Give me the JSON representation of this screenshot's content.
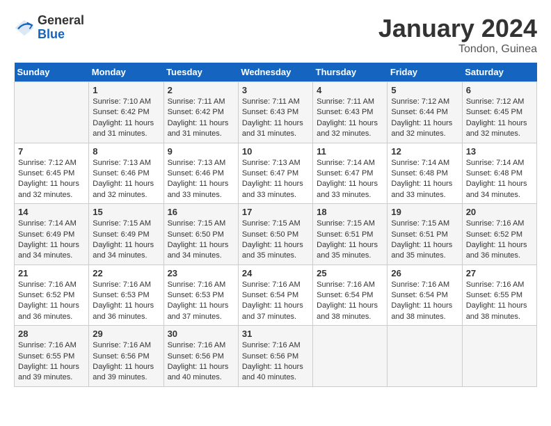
{
  "header": {
    "logo_line1": "General",
    "logo_line2": "Blue",
    "month": "January 2024",
    "location": "Tondon, Guinea"
  },
  "weekdays": [
    "Sunday",
    "Monday",
    "Tuesday",
    "Wednesday",
    "Thursday",
    "Friday",
    "Saturday"
  ],
  "weeks": [
    [
      {
        "day": "",
        "info": ""
      },
      {
        "day": "1",
        "info": "Sunrise: 7:10 AM\nSunset: 6:42 PM\nDaylight: 11 hours and 31 minutes."
      },
      {
        "day": "2",
        "info": "Sunrise: 7:11 AM\nSunset: 6:42 PM\nDaylight: 11 hours and 31 minutes."
      },
      {
        "day": "3",
        "info": "Sunrise: 7:11 AM\nSunset: 6:43 PM\nDaylight: 11 hours and 31 minutes."
      },
      {
        "day": "4",
        "info": "Sunrise: 7:11 AM\nSunset: 6:43 PM\nDaylight: 11 hours and 32 minutes."
      },
      {
        "day": "5",
        "info": "Sunrise: 7:12 AM\nSunset: 6:44 PM\nDaylight: 11 hours and 32 minutes."
      },
      {
        "day": "6",
        "info": "Sunrise: 7:12 AM\nSunset: 6:45 PM\nDaylight: 11 hours and 32 minutes."
      }
    ],
    [
      {
        "day": "7",
        "info": "Sunrise: 7:12 AM\nSunset: 6:45 PM\nDaylight: 11 hours and 32 minutes."
      },
      {
        "day": "8",
        "info": "Sunrise: 7:13 AM\nSunset: 6:46 PM\nDaylight: 11 hours and 32 minutes."
      },
      {
        "day": "9",
        "info": "Sunrise: 7:13 AM\nSunset: 6:46 PM\nDaylight: 11 hours and 33 minutes."
      },
      {
        "day": "10",
        "info": "Sunrise: 7:13 AM\nSunset: 6:47 PM\nDaylight: 11 hours and 33 minutes."
      },
      {
        "day": "11",
        "info": "Sunrise: 7:14 AM\nSunset: 6:47 PM\nDaylight: 11 hours and 33 minutes."
      },
      {
        "day": "12",
        "info": "Sunrise: 7:14 AM\nSunset: 6:48 PM\nDaylight: 11 hours and 33 minutes."
      },
      {
        "day": "13",
        "info": "Sunrise: 7:14 AM\nSunset: 6:48 PM\nDaylight: 11 hours and 34 minutes."
      }
    ],
    [
      {
        "day": "14",
        "info": "Sunrise: 7:14 AM\nSunset: 6:49 PM\nDaylight: 11 hours and 34 minutes."
      },
      {
        "day": "15",
        "info": "Sunrise: 7:15 AM\nSunset: 6:49 PM\nDaylight: 11 hours and 34 minutes."
      },
      {
        "day": "16",
        "info": "Sunrise: 7:15 AM\nSunset: 6:50 PM\nDaylight: 11 hours and 34 minutes."
      },
      {
        "day": "17",
        "info": "Sunrise: 7:15 AM\nSunset: 6:50 PM\nDaylight: 11 hours and 35 minutes."
      },
      {
        "day": "18",
        "info": "Sunrise: 7:15 AM\nSunset: 6:51 PM\nDaylight: 11 hours and 35 minutes."
      },
      {
        "day": "19",
        "info": "Sunrise: 7:15 AM\nSunset: 6:51 PM\nDaylight: 11 hours and 35 minutes."
      },
      {
        "day": "20",
        "info": "Sunrise: 7:16 AM\nSunset: 6:52 PM\nDaylight: 11 hours and 36 minutes."
      }
    ],
    [
      {
        "day": "21",
        "info": "Sunrise: 7:16 AM\nSunset: 6:52 PM\nDaylight: 11 hours and 36 minutes."
      },
      {
        "day": "22",
        "info": "Sunrise: 7:16 AM\nSunset: 6:53 PM\nDaylight: 11 hours and 36 minutes."
      },
      {
        "day": "23",
        "info": "Sunrise: 7:16 AM\nSunset: 6:53 PM\nDaylight: 11 hours and 37 minutes."
      },
      {
        "day": "24",
        "info": "Sunrise: 7:16 AM\nSunset: 6:54 PM\nDaylight: 11 hours and 37 minutes."
      },
      {
        "day": "25",
        "info": "Sunrise: 7:16 AM\nSunset: 6:54 PM\nDaylight: 11 hours and 38 minutes."
      },
      {
        "day": "26",
        "info": "Sunrise: 7:16 AM\nSunset: 6:54 PM\nDaylight: 11 hours and 38 minutes."
      },
      {
        "day": "27",
        "info": "Sunrise: 7:16 AM\nSunset: 6:55 PM\nDaylight: 11 hours and 38 minutes."
      }
    ],
    [
      {
        "day": "28",
        "info": "Sunrise: 7:16 AM\nSunset: 6:55 PM\nDaylight: 11 hours and 39 minutes."
      },
      {
        "day": "29",
        "info": "Sunrise: 7:16 AM\nSunset: 6:56 PM\nDaylight: 11 hours and 39 minutes."
      },
      {
        "day": "30",
        "info": "Sunrise: 7:16 AM\nSunset: 6:56 PM\nDaylight: 11 hours and 40 minutes."
      },
      {
        "day": "31",
        "info": "Sunrise: 7:16 AM\nSunset: 6:56 PM\nDaylight: 11 hours and 40 minutes."
      },
      {
        "day": "",
        "info": ""
      },
      {
        "day": "",
        "info": ""
      },
      {
        "day": "",
        "info": ""
      }
    ]
  ]
}
